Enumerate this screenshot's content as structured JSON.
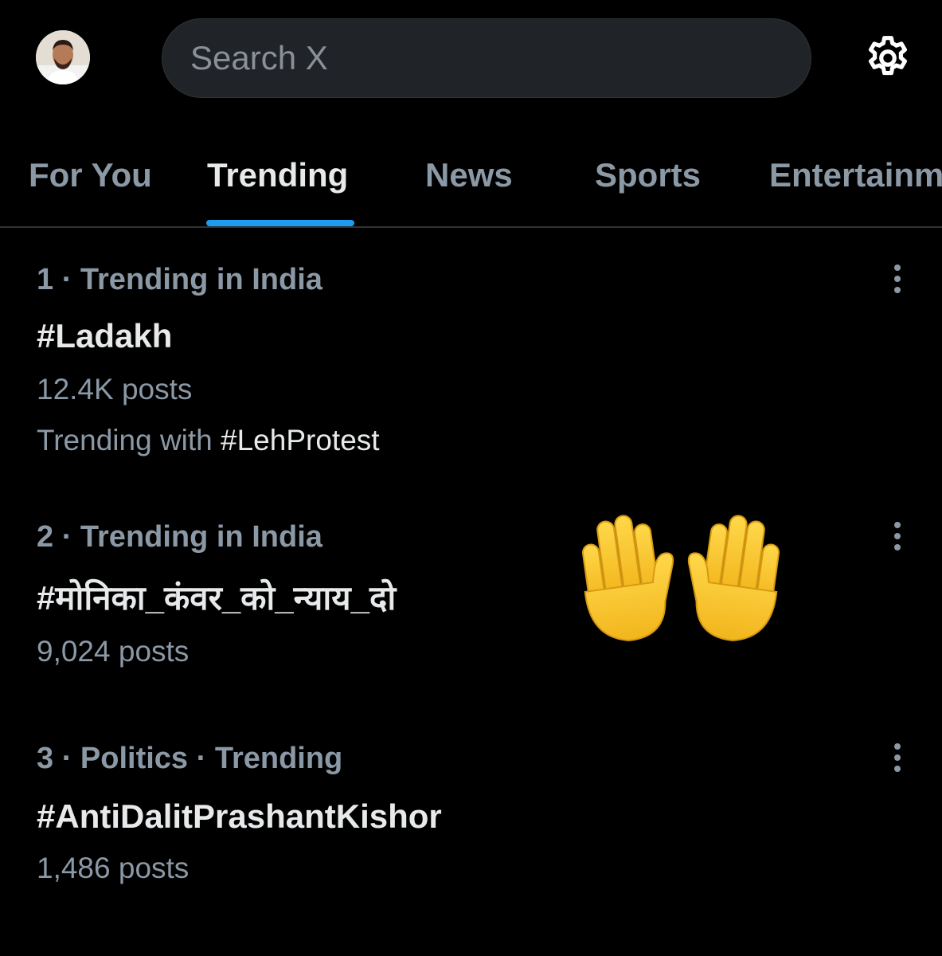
{
  "header": {
    "avatar_icon": "user-avatar",
    "search_placeholder": "Search X",
    "settings_icon": "gear-icon"
  },
  "tabs": [
    {
      "label": "For You",
      "active": false
    },
    {
      "label": "Trending",
      "active": true
    },
    {
      "label": "News",
      "active": false
    },
    {
      "label": "Sports",
      "active": false
    },
    {
      "label": "Entertainment",
      "active": false
    }
  ],
  "trends": [
    {
      "meta": "1 · Trending in India",
      "tag": "#Ladakh",
      "count": "12.4K posts",
      "with_prefix": "Trending with",
      "with_tag": "#LehProtest"
    },
    {
      "meta": "2 · Trending in India",
      "tag": "#मोनिका_कंवर_को_न्याय_दो",
      "count": "9,024 posts"
    },
    {
      "meta": "3 · Politics · Trending",
      "tag": "#AntiDalitPrashantKishor",
      "count": "1,486 posts"
    }
  ],
  "overlay": {
    "emoji_icon": "raising-hands-emoji"
  },
  "colors": {
    "accent": "#1d9bf0",
    "muted": "#8b98a5",
    "text": "#e7e9ea",
    "background": "#000000"
  }
}
